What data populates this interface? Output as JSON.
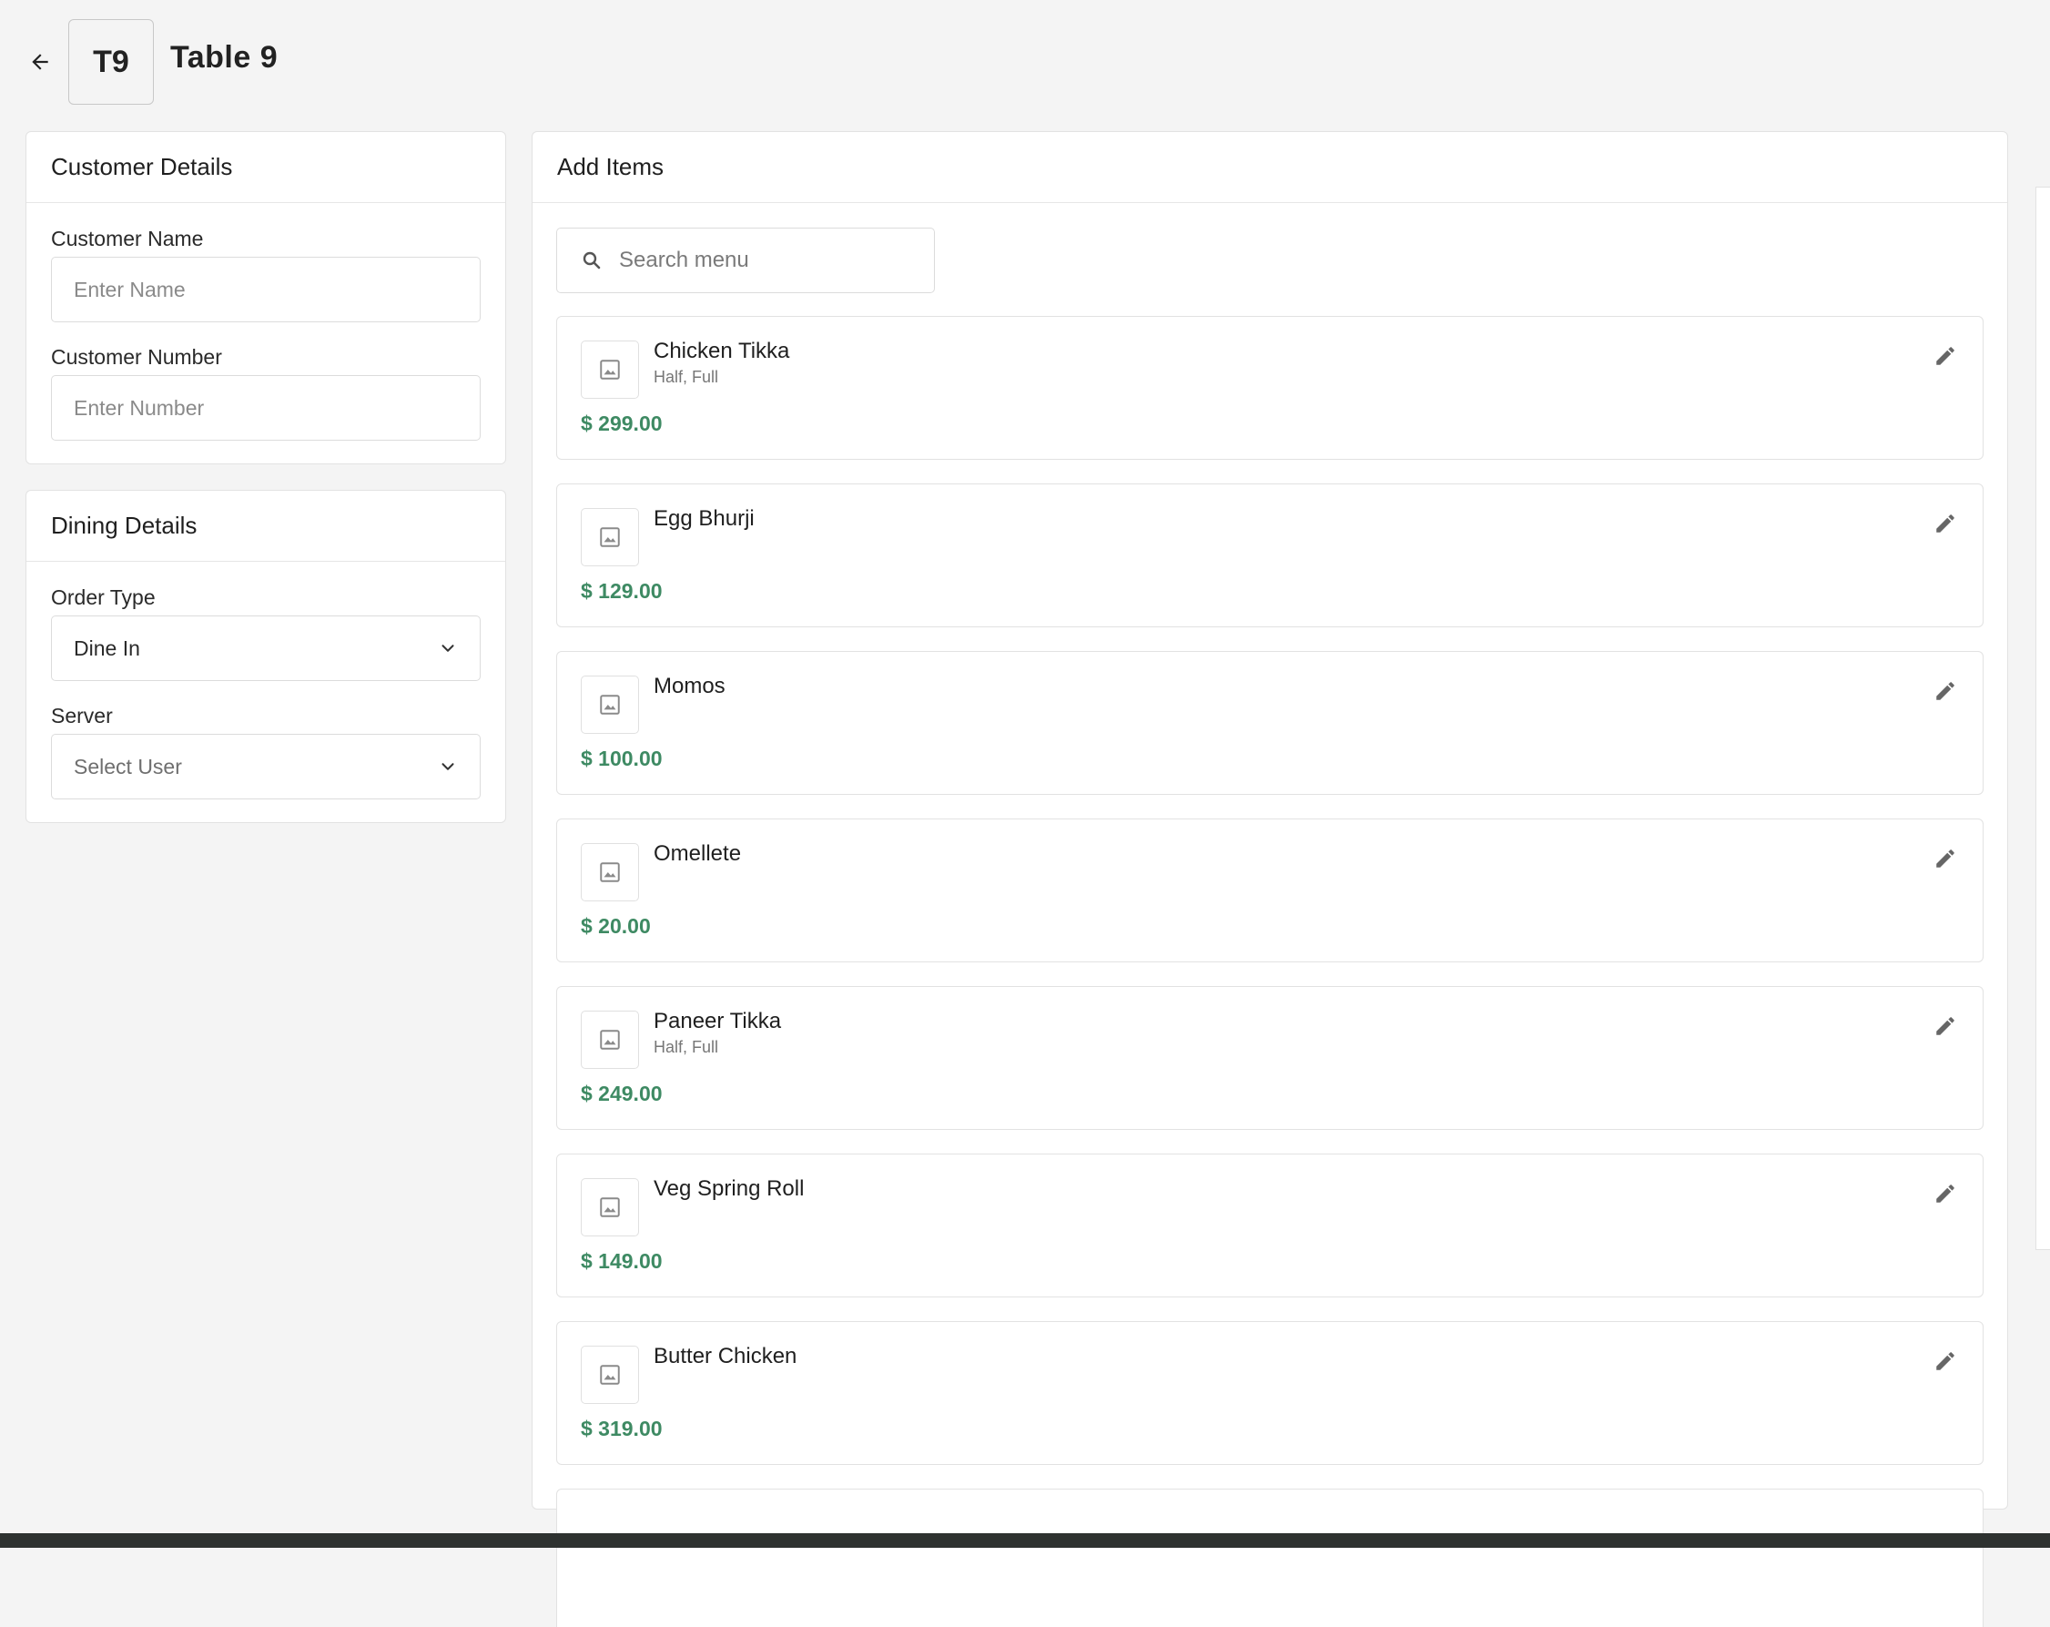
{
  "header": {
    "table_code": "T9",
    "title": "Table 9",
    "back_icon": "arrow-left-icon"
  },
  "customer_details": {
    "title": "Customer Details",
    "name_label": "Customer Name",
    "name_placeholder": "Enter Name",
    "number_label": "Customer Number",
    "number_placeholder": "Enter Number"
  },
  "dining_details": {
    "title": "Dining Details",
    "order_type_label": "Order Type",
    "order_type_value": "Dine In",
    "server_label": "Server",
    "server_placeholder": "Select User"
  },
  "add_items": {
    "title": "Add Items",
    "search_placeholder": "Search menu",
    "items": [
      {
        "name": "Chicken Tikka",
        "variants": "Half, Full",
        "price": "$ 299.00"
      },
      {
        "name": "Egg Bhurji",
        "variants": "",
        "price": "$ 129.00"
      },
      {
        "name": "Momos",
        "variants": "",
        "price": "$ 100.00"
      },
      {
        "name": "Omellete",
        "variants": "",
        "price": "$ 20.00"
      },
      {
        "name": "Paneer Tikka",
        "variants": "Half, Full",
        "price": "$ 249.00"
      },
      {
        "name": "Veg Spring Roll",
        "variants": "",
        "price": "$ 149.00"
      },
      {
        "name": "Butter Chicken",
        "variants": "",
        "price": "$ 319.00"
      }
    ]
  },
  "colors": {
    "price": "#3e8a63",
    "background": "#f4f4f4",
    "card": "#ffffff",
    "border": "#e2e2e2"
  }
}
